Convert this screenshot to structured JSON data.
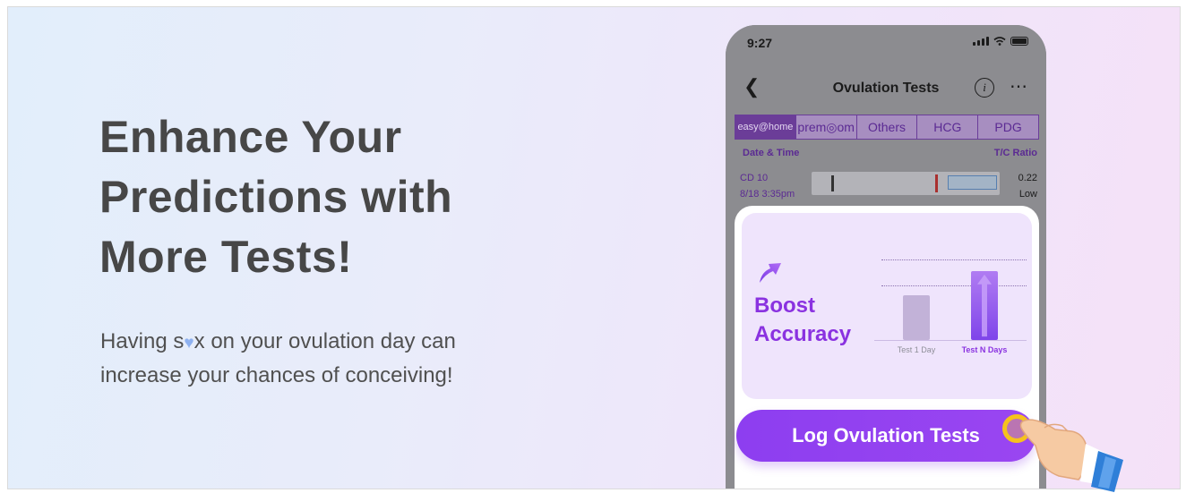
{
  "banner": {
    "headline": [
      "Enhance Your",
      "Predictions with",
      "More Tests!"
    ],
    "subtitle": {
      "line1_before": "Having s",
      "line1_heart_icon": "heart-icon",
      "line1_after": "x on your ovulation day can",
      "line2": "increase your chances of conceiving!"
    }
  },
  "phone": {
    "status_time": "9:27",
    "nav_title": "Ovulation Tests",
    "brand_tabs": [
      "easy@home",
      "prem◎om",
      "Others",
      "HCG",
      "PDG"
    ],
    "columns": {
      "left": "Date & Time",
      "right": "T/C Ratio"
    },
    "row": {
      "cd": "CD 10",
      "datetime": "8/18  3:35pm",
      "ratio": "0.22",
      "level": "Low"
    },
    "popup": {
      "boost_title": [
        "Boost",
        "Accuracy"
      ],
      "chart_data": {
        "type": "bar",
        "categories": [
          "Test 1 Day",
          "Test N Days"
        ],
        "values": [
          0.55,
          0.85
        ],
        "ylim": [
          0,
          1
        ]
      },
      "cta_label": "Log Ovulation Tests"
    }
  },
  "colors": {
    "accent": "#8a32e0",
    "button": "#8d3ef0",
    "ring": "#f6c21d",
    "headline": "#474747"
  }
}
